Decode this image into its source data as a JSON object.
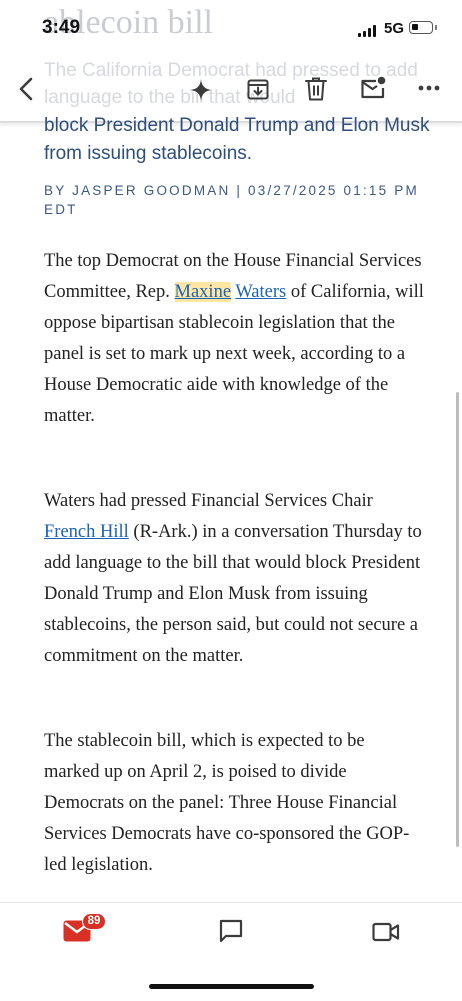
{
  "status_bar": {
    "time": "3:49",
    "network": "5G",
    "battery_level": 0.35
  },
  "background": {
    "heading_fragment": "ablecoin bill",
    "subtitle_fragment": "The California Democrat had pressed to add language to the bill that would"
  },
  "toolbar": {
    "back_icon": "chevron-left-icon",
    "ai_icon": "sparkle-icon",
    "archive_icon": "archive-icon",
    "delete_icon": "trash-icon",
    "unread_icon": "mail-dot-icon",
    "more_icon": "more-horizontal-icon"
  },
  "article": {
    "subtitle_tail": "block President Donald Trump and Elon Musk from issuing stablecoins.",
    "byline": "BY JASPER GOODMAN | 03/27/2025 01:15 PM EDT",
    "p1": {
      "before": "The top Democrat on the House Financial Services Committee, Rep. ",
      "link_first": "Maxine",
      "link_last": "Waters",
      "after": " of California, will oppose bipartisan stablecoin legislation that the panel is set to mark up next week, according to a House Democratic aide with knowledge of the matter."
    },
    "p2": {
      "before": "Waters had pressed Financial Services Chair ",
      "link": "French Hill",
      "after": " (R-Ark.) in a conversation Thursday to add language to the bill that would block President Donald Trump and Elon Musk from issuing stablecoins, the person said, but could not secure a commitment on the matter."
    },
    "p3": "The stablecoin bill, which is expected to be marked up on April 2, is poised to divide Democrats on the panel: Three House Financial Services Democrats have co-sponsored the GOP-led legislation."
  },
  "bottom_nav": {
    "mail_badge": "89",
    "mail_icon": "mail-icon",
    "chat_icon": "chat-icon",
    "meet_icon": "video-icon"
  },
  "colors": {
    "accent": "#d93025",
    "link": "#1a63b5",
    "highlight": "#ffe7a3",
    "byline": "#3c5a82"
  }
}
